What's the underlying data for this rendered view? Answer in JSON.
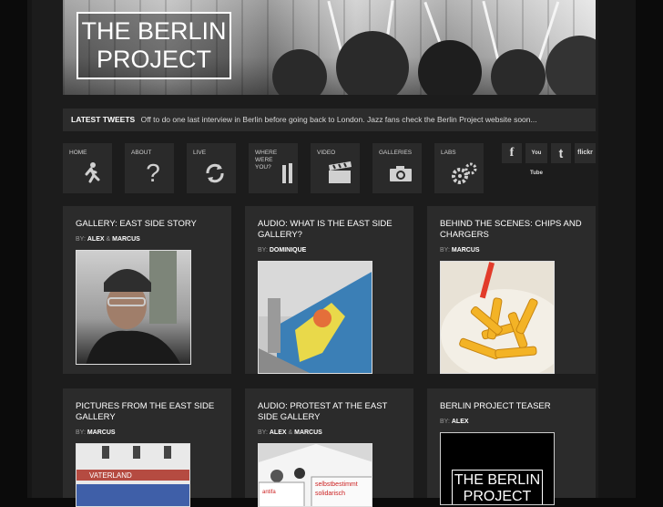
{
  "logo": {
    "line1": "THE BERLIN",
    "line2": "PROJECT"
  },
  "tweets": {
    "label": "LATEST TWEETS",
    "text": "Off to do one last interview in Berlin before going back to London. Jazz fans check the Berlin Project website soon..."
  },
  "nav": {
    "items": [
      {
        "label": "HOME",
        "icon": "running-man-icon"
      },
      {
        "label": "ABOUT",
        "icon": "question-mark-icon"
      },
      {
        "label": "LIVE",
        "icon": "refresh-icon"
      },
      {
        "label": "WHERE\nWERE\nYOU?",
        "icon": "hands-icon"
      },
      {
        "label": "VIDEO",
        "icon": "clapperboard-icon"
      },
      {
        "label": "GALLERIES",
        "icon": "camera-icon"
      },
      {
        "label": "LABS",
        "icon": "gears-icon"
      }
    ]
  },
  "social": {
    "facebook": "f",
    "youtube": "You Tube",
    "twitter": "t",
    "flickr": "flickr"
  },
  "cards": [
    {
      "title": "GALLERY: EAST SIDE STORY",
      "by_label": "BY:",
      "author1": "ALEX",
      "amp": "&",
      "author2": "MARCUS"
    },
    {
      "title": "AUDIO: WHAT IS THE EAST SIDE GALLERY?",
      "by_label": "BY:",
      "author1": "DOMINIQUE"
    },
    {
      "title": "BEHIND THE SCENES: CHIPS AND CHARGERS",
      "by_label": "BY:",
      "author1": "MARCUS"
    },
    {
      "title": "PICTURES FROM THE EAST SIDE GALLERY",
      "by_label": "BY:",
      "author1": "MARCUS"
    },
    {
      "title": "AUDIO: PROTEST AT THE EAST SIDE GALLERY",
      "by_label": "BY:",
      "author1": "ALEX",
      "amp": "&",
      "author2": "MARCUS"
    },
    {
      "title": "BERLIN PROJECT TEASER",
      "by_label": "BY:",
      "author1": "ALEX",
      "teaser_line1": "THE BERLIN",
      "teaser_line2": "PROJECT"
    }
  ],
  "photos": {
    "shop_sign": "VATERLAND",
    "banner1": "selbstbestimmt",
    "banner2": "solidarisch",
    "banner3": "antifa"
  }
}
